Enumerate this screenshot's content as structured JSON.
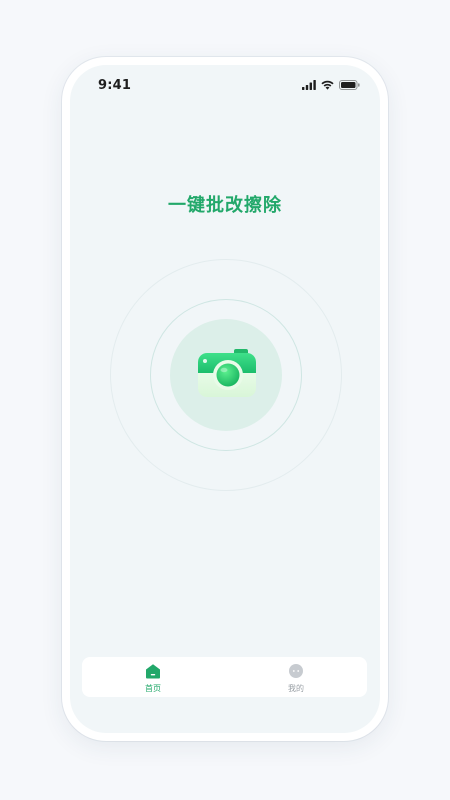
{
  "status_bar": {
    "time": "9:41"
  },
  "main": {
    "title": "一键批改擦除"
  },
  "tab_bar": {
    "tabs": [
      {
        "label": "首页",
        "icon": "home-icon",
        "active": true
      },
      {
        "label": "我的",
        "icon": "profile-icon",
        "active": false
      }
    ]
  },
  "colors": {
    "accent": "#22a86a",
    "background": "#f1f6f8",
    "inactive": "#9aa0a6"
  }
}
